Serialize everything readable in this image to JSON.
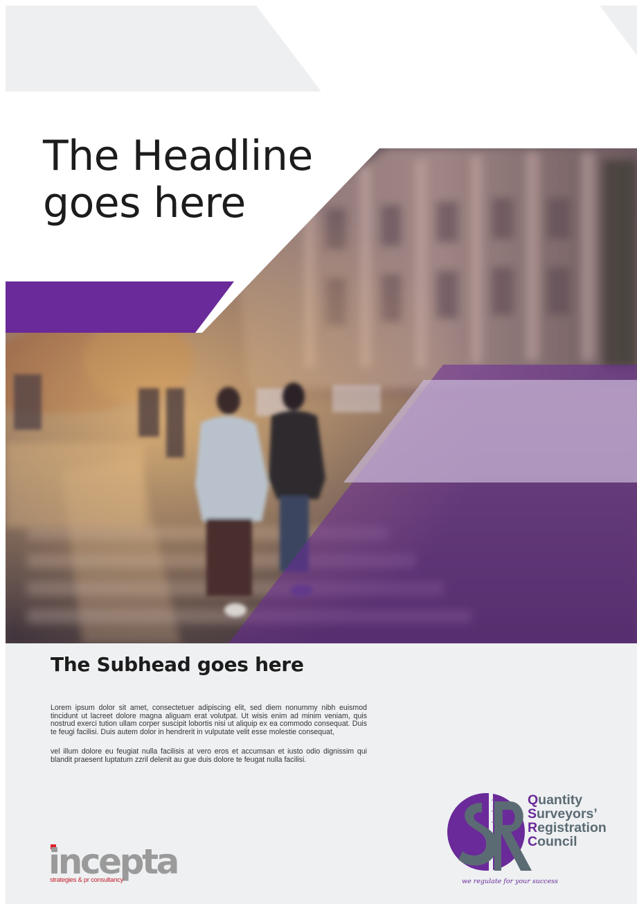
{
  "headline": {
    "line1": "The Headline",
    "line2": "goes here"
  },
  "subhead": "The Subhead goes here",
  "body": {
    "paragraphs": [
      "Lorem ipsum dolor sit amet, consectetuer adipiscing elit, sed diem nonummy nibh euismod tincidunt ut lacreet dolore magna aliguam erat volutpat. Ut wisis enim ad minim veniam, quis nostrud exerci tution ullam corper suscipit lobortis nisi ut aliquip ex ea commodo consequat. Duis te feugi facilisi. Duis autem dolor in hendrerit in vulputate velit esse molestie consequat,",
      "vel illum dolore eu feugiat nulla facilisis at vero eros et accumsan et iusto odio dignissim qui blandit praesent luptatum zzril delenit au gue duis dolore te feugat nulla facilisi."
    ]
  },
  "incepta": {
    "wordmark": "incepta",
    "tagline": "strategies & pr consultancy"
  },
  "qsrc": {
    "lines": [
      {
        "initial": "Q",
        "rest": "uantity"
      },
      {
        "initial": "S",
        "rest": "urveyors’"
      },
      {
        "initial": "R",
        "rest": "egistration"
      },
      {
        "initial": "C",
        "rest": "ouncil"
      }
    ],
    "tagline": "we regulate for your success",
    "emblem_letters": "SR"
  },
  "colors": {
    "brand_purple": "#6a2a99",
    "panel_grey": "#eef0f2",
    "logo_grey": "#5b6b73",
    "incepta_red": "#c41f2a"
  }
}
